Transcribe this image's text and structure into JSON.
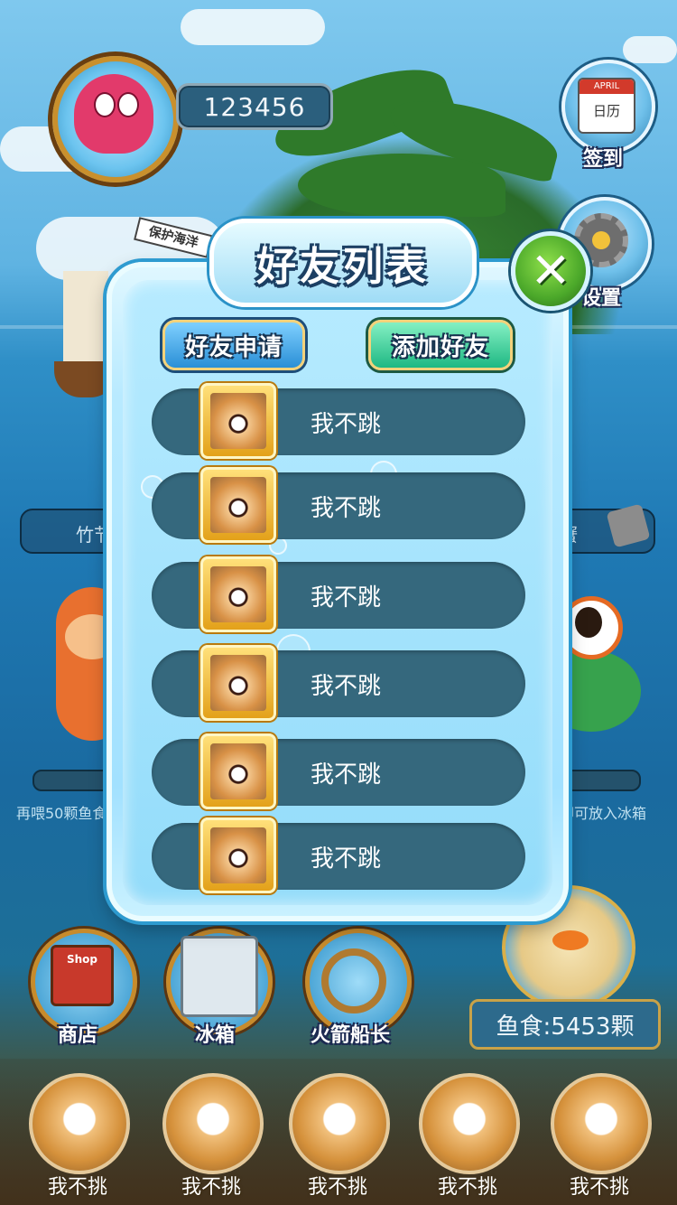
{
  "player": {
    "score": "123456"
  },
  "side_buttons": [
    {
      "label": "签到",
      "calendar_month": "APRIL",
      "calendar_text": "日历",
      "icon": "calendar-icon"
    },
    {
      "label": "设置",
      "icon": "gear-icon"
    }
  ],
  "ship_flag": "保护海洋",
  "background_texts": {
    "left_bar": "竹节",
    "right_bar": "子蟹",
    "hint_left": "再喂50颗鱼食",
    "hint_right": "食即可放入冰箱"
  },
  "dialog": {
    "title": "好友列表",
    "close_icon": "close-icon",
    "buttons": [
      {
        "label": "好友申请",
        "color": "#2a8fd6"
      },
      {
        "label": "添加好友",
        "color": "#1fb883"
      }
    ],
    "friends": [
      {
        "name": "我不跳"
      },
      {
        "name": "我不跳"
      },
      {
        "name": "我不跳"
      },
      {
        "name": "我不跳"
      },
      {
        "name": "我不跳"
      },
      {
        "name": "我不跳"
      }
    ]
  },
  "bottom_menu": [
    {
      "label": "商店",
      "icon": "shop-icon",
      "sign": "Shop"
    },
    {
      "label": "冰箱",
      "icon": "fridge-icon"
    },
    {
      "label": "火箭船长",
      "icon": "captain-icon"
    }
  ],
  "fish_food": "鱼食:5453颗",
  "friend_strip": [
    {
      "name": "我不挑"
    },
    {
      "name": "我不挑"
    },
    {
      "name": "我不挑"
    },
    {
      "name": "我不挑"
    },
    {
      "name": "我不挑"
    }
  ],
  "colors": {
    "dialog_border": "#2e9bd0",
    "row_bg": "#35687d",
    "close_green": "#4ba82a",
    "title_outline": "#1c3f63"
  }
}
